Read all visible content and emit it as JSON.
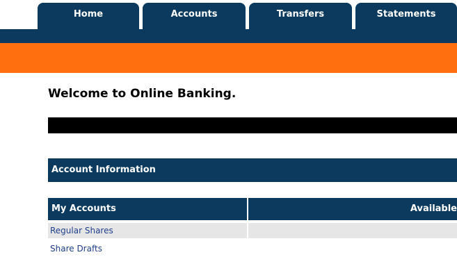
{
  "tabs": [
    {
      "label": "Home",
      "active": true
    },
    {
      "label": "Accounts",
      "active": false
    },
    {
      "label": "Transfers",
      "active": false
    },
    {
      "label": "Statements",
      "active": false
    }
  ],
  "welcome": "Welcome to Online Banking.",
  "account_info_header": "Account Information",
  "table": {
    "columns": [
      "My Accounts",
      "Available"
    ],
    "rows": [
      {
        "name": "Regular Shares",
        "available": ""
      },
      {
        "name": "Share Drafts",
        "available": ""
      }
    ]
  },
  "colors": {
    "navy": "#0b3a5e",
    "orange": "#ff6f0f",
    "link": "#1f3f8a",
    "row_shade": "#e6e6e6"
  }
}
